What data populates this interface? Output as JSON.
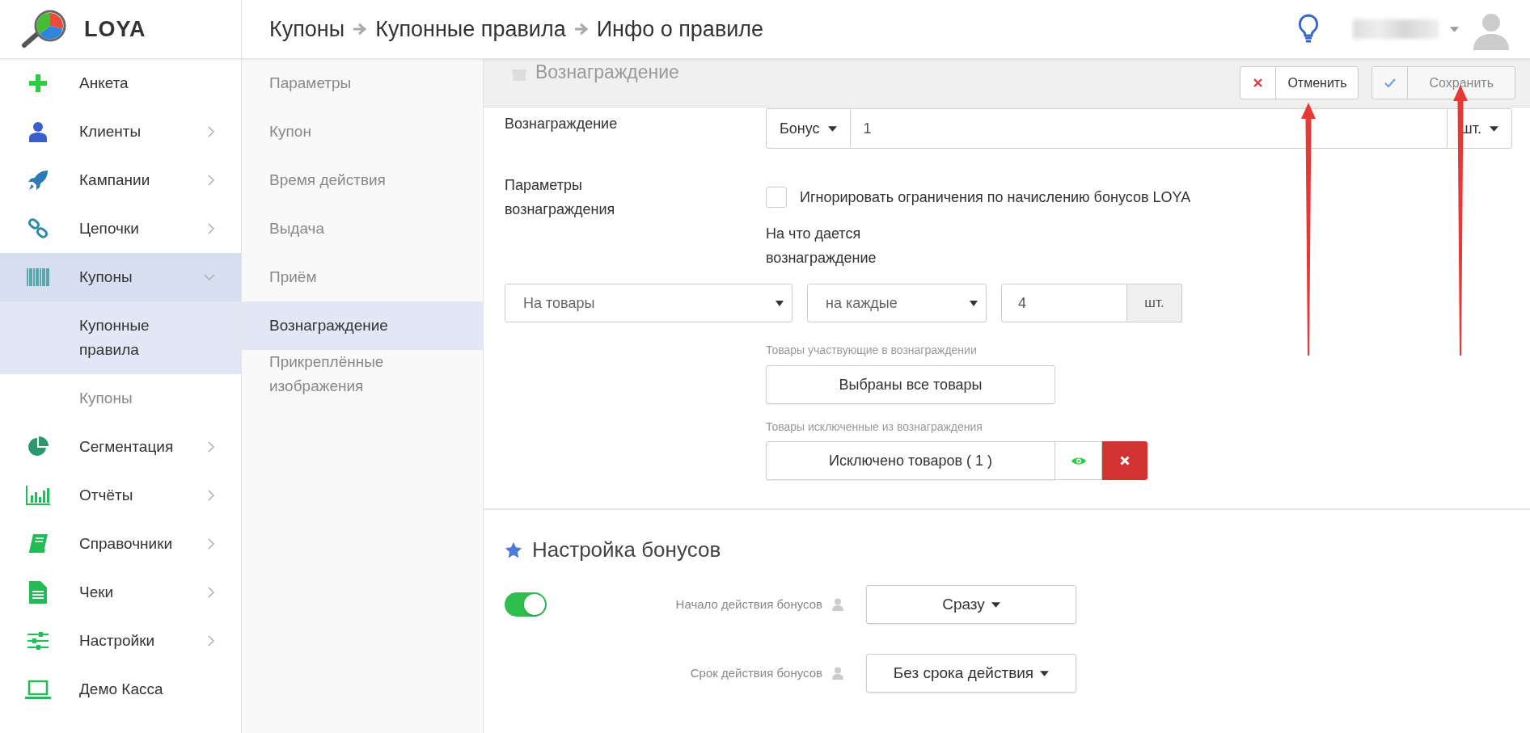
{
  "header": {
    "logo_text": "LOYA",
    "breadcrumb": [
      "Купоны",
      "Купонные правила",
      "Инфо о правиле"
    ]
  },
  "sidebar": {
    "items": [
      {
        "label": "Анкета",
        "has_submenu": false,
        "expanded": false,
        "selected": false
      },
      {
        "label": "Клиенты",
        "has_submenu": true,
        "expanded": false,
        "selected": false
      },
      {
        "label": "Кампании",
        "has_submenu": true,
        "expanded": false,
        "selected": false
      },
      {
        "label": "Цепочки",
        "has_submenu": true,
        "expanded": false,
        "selected": false
      },
      {
        "label": "Купоны",
        "has_submenu": true,
        "expanded": true,
        "selected": true,
        "children": [
          {
            "label": "Купонные правила",
            "selected": true
          },
          {
            "label": "Купоны",
            "selected": false
          }
        ]
      },
      {
        "label": "Сегментация",
        "has_submenu": true,
        "expanded": false,
        "selected": false
      },
      {
        "label": "Отчёты",
        "has_submenu": true,
        "expanded": false,
        "selected": false
      },
      {
        "label": "Справочники",
        "has_submenu": true,
        "expanded": false,
        "selected": false
      },
      {
        "label": "Чеки",
        "has_submenu": true,
        "expanded": false,
        "selected": false
      },
      {
        "label": "Настройки",
        "has_submenu": true,
        "expanded": false,
        "selected": false
      },
      {
        "label": "Демо Касса",
        "has_submenu": false,
        "expanded": false,
        "selected": false
      }
    ]
  },
  "subnav": [
    {
      "label": "Параметры",
      "selected": false
    },
    {
      "label": "Купон",
      "selected": false
    },
    {
      "label": "Время действия",
      "selected": false
    },
    {
      "label": "Выдача",
      "selected": false
    },
    {
      "label": "Приём",
      "selected": false
    },
    {
      "label": "Вознаграждение",
      "selected": true
    },
    {
      "label": "Прикреплённые изображения",
      "selected": false
    }
  ],
  "action_bar": {
    "title": "Вознаграждение",
    "buttons": [
      {
        "label": "Отменить",
        "kind": "cancel",
        "disabled": false
      },
      {
        "label": "Сохранить",
        "kind": "save",
        "disabled": true
      }
    ]
  },
  "reward": {
    "label": "Вознаграждение",
    "type": "Бонус",
    "amount": "1",
    "unit": "шт."
  },
  "reward_params": {
    "label": "Параметры вознаграждения",
    "ignore_limits": {
      "label": "Игнорировать ограничения по начислению бонусов LOYA",
      "checked": false
    },
    "target_label": "На что дается вознаграждение",
    "target": "На товары",
    "per": "на каждые",
    "count": "4",
    "count_unit": "шт.",
    "included_label": "Товары участвующие в вознаграждении",
    "included_button": "Выбраны все товары",
    "excluded_label": "Товары исключенные из вознаграждения",
    "excluded_button": "Исключено товаров ( 1 )"
  },
  "bonus_settings": {
    "title": "Настройка бонусов",
    "enabled": true,
    "fields": [
      {
        "label": "Начало действия бонусов",
        "value": "Сразу"
      },
      {
        "label": "Срок действия бонусов",
        "value": "Без срока действия"
      }
    ]
  },
  "annotations": [
    {
      "kind": "arrow"
    },
    {
      "kind": "arrow"
    }
  ]
}
